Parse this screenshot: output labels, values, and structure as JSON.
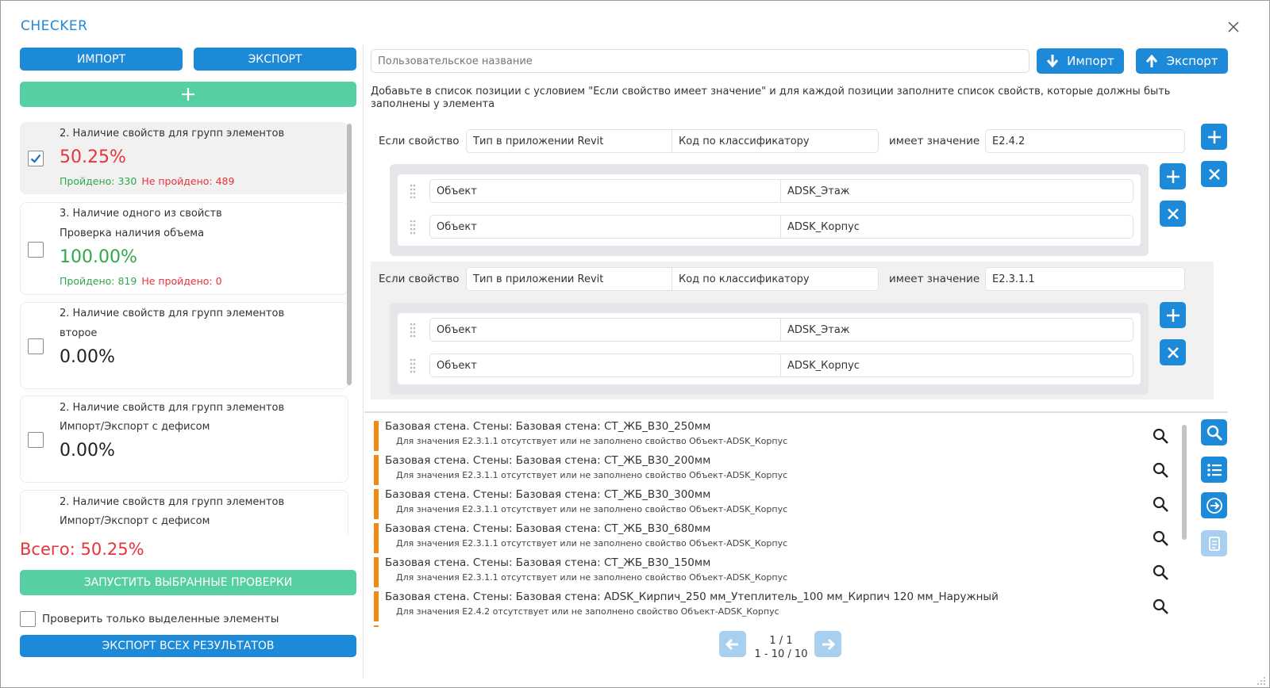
{
  "app": {
    "title": "CHECKER"
  },
  "left": {
    "import_label": "ИМПОРТ",
    "export_label": "ЭКСПОРТ",
    "add_label": "+",
    "checks": [
      {
        "line1": "2. Наличие свойств для групп элементов",
        "line2": "",
        "percent": "50.25%",
        "passed": "Пройдено: 330",
        "failed": "Не пройдено: 489",
        "checked": true
      },
      {
        "line1": "3. Наличие одного из свойств",
        "line2": "Проверка наличия объема",
        "percent": "100.00%",
        "passed": "Пройдено: 819",
        "failed": "Не пройдено: 0",
        "checked": false
      },
      {
        "line1": "2. Наличие свойств для групп элементов",
        "line2": "второе",
        "percent": "0.00%",
        "checked": false
      },
      {
        "line1": "2. Наличие свойств для групп элементов",
        "line2": "Импорт/Экспорт с дефисом",
        "percent": "0.00%",
        "checked": false
      },
      {
        "line1": "2. Наличие свойств для групп элементов",
        "line2": "Импорт/Экспорт с дефисом",
        "checked": false
      }
    ],
    "total": "Всего: 50.25%",
    "run_label": "ЗАПУСТИТЬ ВЫБРАННЫЕ ПРОВЕРКИ",
    "only_selected_label": "Проверить только выделенные элементы",
    "export_all_label": "ЭКСПОРТ ВСЕХ РЕЗУЛЬТАТОВ"
  },
  "editor": {
    "name_placeholder": "Пользовательское название",
    "import_label": "Импорт",
    "export_label": "Экспорт",
    "hint": "Добавьте в список позиции с условием \"Если свойство имеет значение\" и для каждой позиции заполните список свойств, которые должны быть заполнены у элемента",
    "rules": [
      {
        "if_label": "Если свойство",
        "prop_group": "Тип в приложении Revit",
        "prop_name": "Код по классификатору",
        "has_value_label": "имеет значение",
        "value": "E2.4.2",
        "required": [
          {
            "group": "Объект",
            "name": "ADSK_Этаж"
          },
          {
            "group": "Объект",
            "name": "ADSK_Корпус"
          }
        ]
      },
      {
        "if_label": "Если свойство",
        "prop_group": "Тип в приложении Revit",
        "prop_name": "Код по классификатору",
        "has_value_label": "имеет значение",
        "value": "E2.3.1.1",
        "required": [
          {
            "group": "Объект",
            "name": "ADSK_Этаж"
          },
          {
            "group": "Объект",
            "name": "ADSK_Корпус"
          }
        ]
      }
    ]
  },
  "results": {
    "items": [
      {
        "title": "Базовая стена. Стены: Базовая стена: СТ_ЖБ_В30_250мм",
        "desc": "Для значения E2.3.1.1 отсутствует или не заполнено свойство Объект-ADSK_Корпус"
      },
      {
        "title": "Базовая стена. Стены: Базовая стена: СТ_ЖБ_В30_200мм",
        "desc": "Для значения E2.3.1.1 отсутствует или не заполнено свойство Объект-ADSK_Корпус"
      },
      {
        "title": "Базовая стена. Стены: Базовая стена: СТ_ЖБ_В30_300мм",
        "desc": "Для значения E2.3.1.1 отсутствует или не заполнено свойство Объект-ADSK_Корпус"
      },
      {
        "title": "Базовая стена. Стены: Базовая стена: СТ_ЖБ_В30_680мм",
        "desc": "Для значения E2.3.1.1 отсутствует или не заполнено свойство Объект-ADSK_Корпус"
      },
      {
        "title": "Базовая стена. Стены: Базовая стена: СТ_ЖБ_В30_150мм",
        "desc": "Для значения E2.3.1.1 отсутствует или не заполнено свойство Объект-ADSK_Корпус"
      },
      {
        "title": "Базовая стена. Стены: Базовая стена: ADSK_Кирпич_250 мм_Утеплитель_100 мм_Кирпич 120 мм_Наружный",
        "desc": "Для значения E2.4.2 отсутствует или не заполнено свойство Объект-ADSK_Корпус"
      }
    ],
    "pager_page": "1 / 1",
    "pager_range": "1 - 10 / 10"
  },
  "colors": {
    "accent": "#1c8ad9",
    "green": "#56cfa3",
    "red": "#e8333a",
    "ok": "#2ea84a",
    "warning": "#f08a10",
    "disabled": "#a8cff0"
  },
  "icons": {
    "close": "close-icon",
    "checkmark": "checkmark-icon",
    "import": "arrow-down-icon",
    "export": "arrow-up-icon",
    "plus": "plus-icon",
    "remove": "x-icon",
    "drag": "drag-handle-icon",
    "search": "search-icon",
    "list": "list-icon",
    "go": "arrow-right-icon",
    "report": "report-icon",
    "prev": "arrow-left-icon",
    "next": "arrow-right-icon"
  }
}
